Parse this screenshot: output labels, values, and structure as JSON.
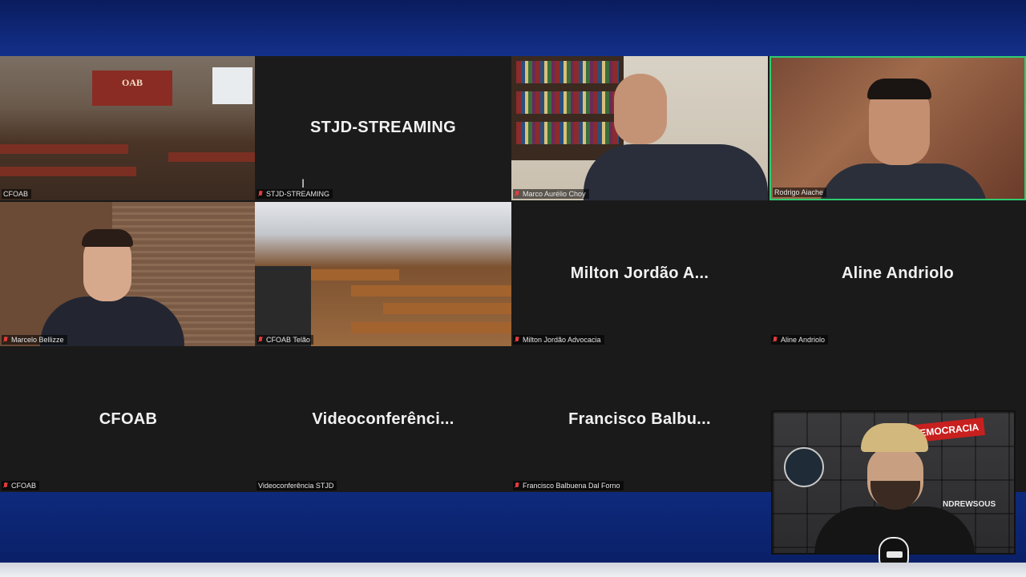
{
  "meeting": {
    "tiles": [
      {
        "id": "t1",
        "name_label": "CFOAB",
        "center_name": "",
        "sign_text": "OAB"
      },
      {
        "id": "t2",
        "name_label": "STJD-STREAMING",
        "center_name": "STJD-STREAMING"
      },
      {
        "id": "t3",
        "name_label": "Marco Aurélio Choy",
        "center_name": ""
      },
      {
        "id": "t4",
        "name_label": "Rodrigo Aiache",
        "center_name": "",
        "speaking": true
      },
      {
        "id": "t5",
        "name_label": "Marcelo Bellizze",
        "center_name": ""
      },
      {
        "id": "t6",
        "name_label": "CFOAB Telão",
        "center_name": ""
      },
      {
        "id": "t7",
        "name_label": "Milton Jordão Advocacia",
        "center_name": "Milton Jordão A..."
      },
      {
        "id": "t8",
        "name_label": "Aline Andriolo",
        "center_name": "Aline Andriolo"
      },
      {
        "id": "t9",
        "name_label": "CFOAB",
        "center_name": "CFOAB"
      },
      {
        "id": "t10",
        "name_label": "Videoconferência STJD",
        "center_name": "Videoconferênci..."
      },
      {
        "id": "t11",
        "name_label": "Francisco Balbuena Dal Forno",
        "center_name": "Francisco Balbu..."
      }
    ]
  },
  "overlay": {
    "banner": "DEMOCRACIA",
    "handle": "NDREWSOUS"
  },
  "colors": {
    "speaking_border": "#2ecc71",
    "mic_muted": "#e23b3b",
    "tile_bg": "#1a1a1a",
    "brand_blue": "#0d2160"
  }
}
